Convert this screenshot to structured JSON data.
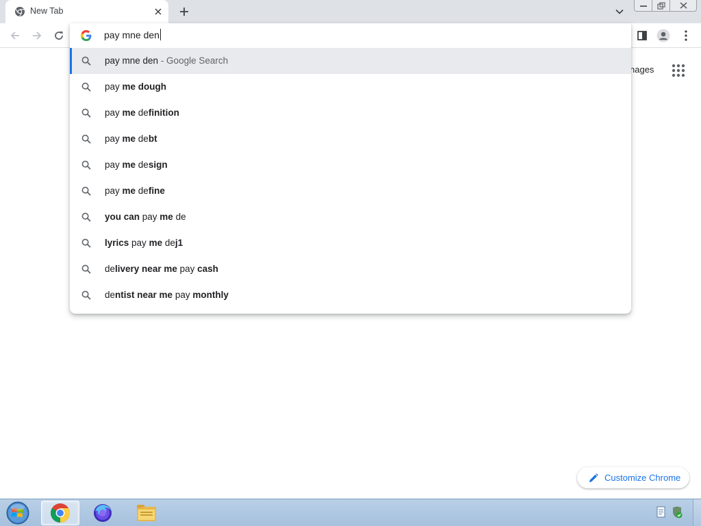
{
  "tab": {
    "title": "New Tab"
  },
  "omnibox": {
    "typed_text": "pay mne den"
  },
  "suggestions": [
    {
      "parts": [
        {
          "t": "pay mne den",
          "b": false
        },
        {
          "t": " - Google Search",
          "b": false,
          "dim": true
        }
      ],
      "selected": true
    },
    {
      "parts": [
        {
          "t": "pay ",
          "b": false
        },
        {
          "t": "me dough",
          "b": true
        }
      ]
    },
    {
      "parts": [
        {
          "t": "pay ",
          "b": false
        },
        {
          "t": "me",
          "b": true
        },
        {
          "t": " de",
          "b": false
        },
        {
          "t": "finition",
          "b": true
        }
      ]
    },
    {
      "parts": [
        {
          "t": "pay ",
          "b": false
        },
        {
          "t": "me",
          "b": true
        },
        {
          "t": " de",
          "b": false
        },
        {
          "t": "bt",
          "b": true
        }
      ]
    },
    {
      "parts": [
        {
          "t": "pay ",
          "b": false
        },
        {
          "t": "me",
          "b": true
        },
        {
          "t": " de",
          "b": false
        },
        {
          "t": "sign",
          "b": true
        }
      ]
    },
    {
      "parts": [
        {
          "t": "pay ",
          "b": false
        },
        {
          "t": "me",
          "b": true
        },
        {
          "t": " de",
          "b": false
        },
        {
          "t": "fine",
          "b": true
        }
      ]
    },
    {
      "parts": [
        {
          "t": "you can",
          "b": true
        },
        {
          "t": " pay ",
          "b": false
        },
        {
          "t": "me",
          "b": true
        },
        {
          "t": " de",
          "b": false
        }
      ]
    },
    {
      "parts": [
        {
          "t": "lyrics",
          "b": true
        },
        {
          "t": " pay ",
          "b": false
        },
        {
          "t": "me",
          "b": true
        },
        {
          "t": " de",
          "b": false
        },
        {
          "t": "j1",
          "b": true
        }
      ]
    },
    {
      "parts": [
        {
          "t": "de",
          "b": false
        },
        {
          "t": "livery near me",
          "b": true
        },
        {
          "t": " pay ",
          "b": false
        },
        {
          "t": "cash",
          "b": true
        }
      ]
    },
    {
      "parts": [
        {
          "t": "de",
          "b": false
        },
        {
          "t": "ntist near me",
          "b": true
        },
        {
          "t": " pay ",
          "b": false
        },
        {
          "t": "monthly",
          "b": true
        }
      ]
    }
  ],
  "header_links": {
    "images": "nages"
  },
  "customize": {
    "label": "Customize Chrome"
  },
  "colors": {
    "accent": "#1a73e8",
    "tabstrip": "#dee1e6",
    "selected_row": "#e8eaed"
  },
  "icons": {
    "tab_favicon": "chrome-icon",
    "omnibox": "google-g-icon",
    "suggestion": "search-icon",
    "apps": "apps-grid-icon",
    "customize": "pencil-icon"
  }
}
